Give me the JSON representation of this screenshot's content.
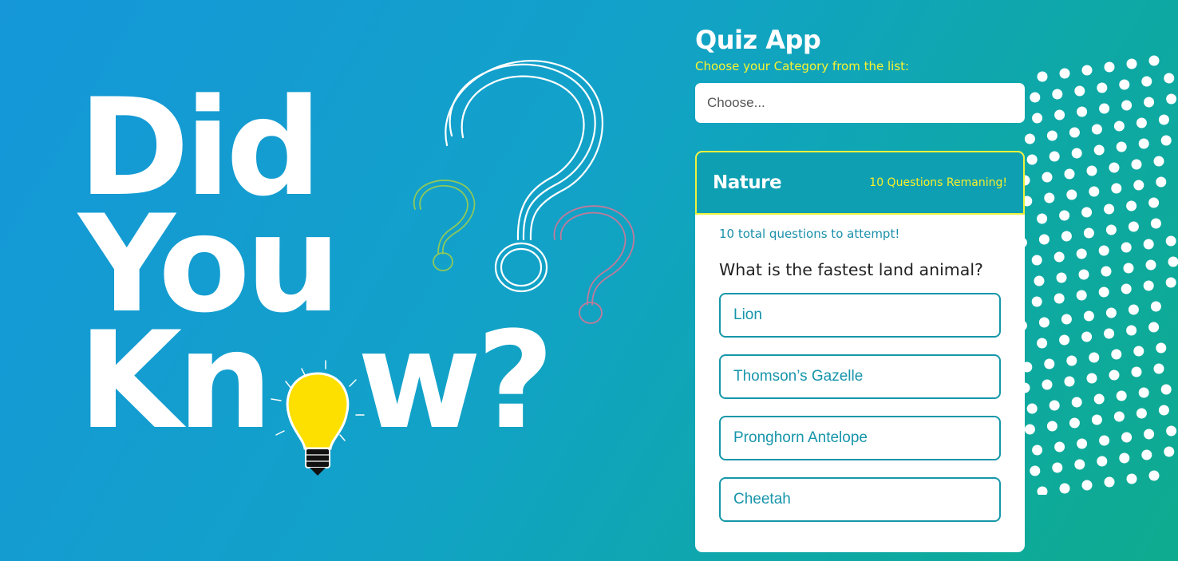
{
  "hero": {
    "line1": "Did",
    "line2": "You",
    "line3_start": "Kn",
    "line3_end": "w?",
    "bulb_icon": "lightbulb-icon",
    "question_marks": [
      "question-mark-white-icon",
      "question-mark-green-icon",
      "question-mark-pink-icon"
    ]
  },
  "app": {
    "title": "Quiz App",
    "subtitle": "Choose your Category from the list:",
    "select_placeholder": "Choose..."
  },
  "card": {
    "category": "Nature",
    "remaining": "10 Questions Remaning!",
    "total_questions": "10 total questions to attempt!",
    "question": "What is the fastest land animal?",
    "answers": [
      "Lion",
      "Thomson’s Gazelle",
      "Pronghorn Antelope",
      "Cheetah"
    ]
  },
  "colors": {
    "accent_yellow": "#f5ef2c",
    "teal": "#0e9fb2",
    "bg_start": "#1597d9",
    "bg_end": "#0fab8f"
  }
}
